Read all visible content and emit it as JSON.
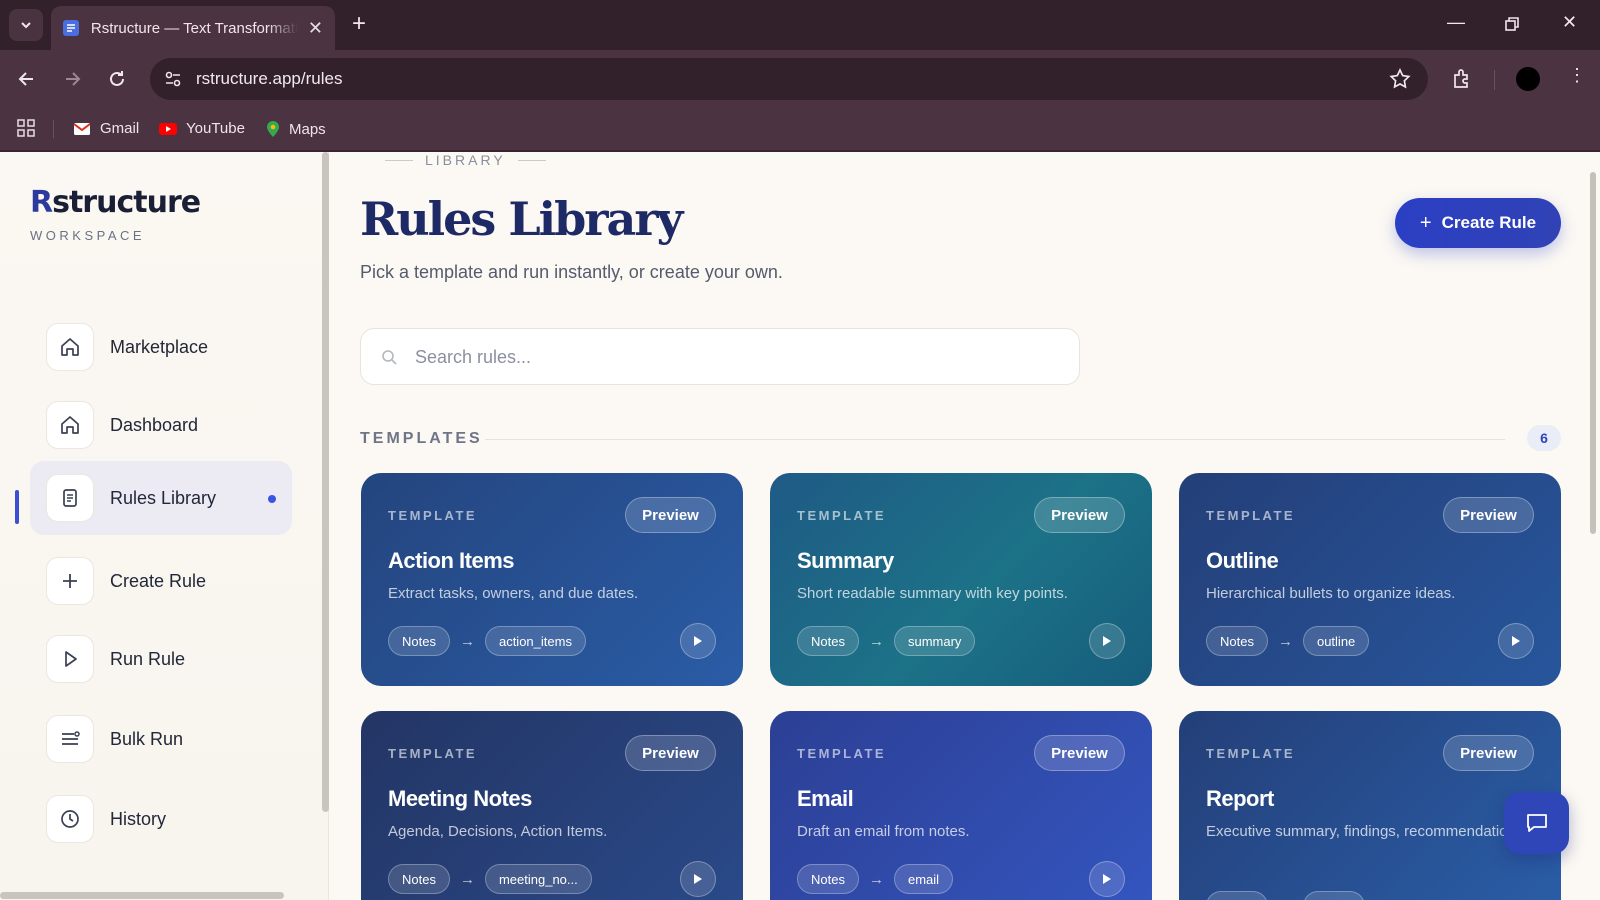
{
  "browser": {
    "tab_title": "Rstructure — Text Transformation",
    "url": "rstructure.app/rules",
    "bookmarks": [
      {
        "label": "Gmail",
        "icon": "gmail-icon"
      },
      {
        "label": "YouTube",
        "icon": "youtube-icon"
      },
      {
        "label": "Maps",
        "icon": "maps-icon"
      }
    ]
  },
  "sidebar": {
    "brand_first": "R",
    "brand_rest": "structure",
    "brand_sub": "WORKSPACE",
    "items": [
      {
        "label": "Marketplace",
        "icon": "home-icon"
      },
      {
        "label": "Dashboard",
        "icon": "home-icon"
      },
      {
        "label": "Rules Library",
        "icon": "document-icon",
        "active": true
      },
      {
        "label": "Create Rule",
        "icon": "plus-icon"
      },
      {
        "label": "Run Rule",
        "icon": "play-icon"
      },
      {
        "label": "Bulk Run",
        "icon": "list-icon"
      },
      {
        "label": "History",
        "icon": "clock-icon"
      }
    ]
  },
  "main": {
    "eyebrow": "LIBRARY",
    "title": "Rules Library",
    "subtitle": "Pick a template and run instantly, or create your own.",
    "create_label": "Create Rule",
    "search_placeholder": "Search rules...",
    "section_title": "TEMPLATES",
    "section_count": "6",
    "cards": [
      {
        "eyebrow": "TEMPLATE",
        "preview": "Preview",
        "title": "Action Items",
        "desc": "Extract tasks, owners, and due dates.",
        "input": "Notes",
        "output": "action_items"
      },
      {
        "eyebrow": "TEMPLATE",
        "preview": "Preview",
        "title": "Summary",
        "desc": "Short readable summary with key points.",
        "input": "Notes",
        "output": "summary"
      },
      {
        "eyebrow": "TEMPLATE",
        "preview": "Preview",
        "title": "Outline",
        "desc": "Hierarchical bullets to organize ideas.",
        "input": "Notes",
        "output": "outline"
      },
      {
        "eyebrow": "TEMPLATE",
        "preview": "Preview",
        "title": "Meeting Notes",
        "desc": "Agenda, Decisions, Action Items.",
        "input": "Notes",
        "output": "meeting_no..."
      },
      {
        "eyebrow": "TEMPLATE",
        "preview": "Preview",
        "title": "Email",
        "desc": "Draft an email from notes.",
        "input": "Notes",
        "output": "email"
      },
      {
        "eyebrow": "TEMPLATE",
        "preview": "Preview",
        "title": "Report",
        "desc": "Executive summary, findings, recommendations.",
        "input": "",
        "output": ""
      }
    ]
  },
  "colors": {
    "accent": "#2b3fc4",
    "title_navy": "#1e2a66",
    "card_blue": "#23508f",
    "card_teal": "#1c6e86"
  }
}
